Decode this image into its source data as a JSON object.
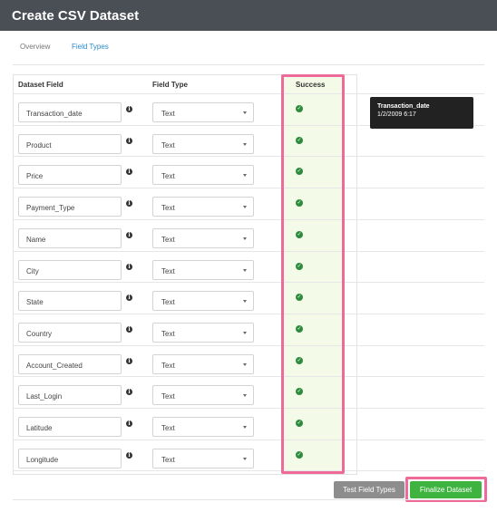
{
  "window": {
    "title": "Create CSV Dataset"
  },
  "tabs": [
    {
      "label": "Overview",
      "active": false
    },
    {
      "label": "Field Types",
      "active": true
    }
  ],
  "table": {
    "headers": {
      "field": "Dataset Field",
      "type": "Field Type",
      "success": "Success"
    },
    "rows": [
      {
        "field": "Transaction_date",
        "type": "Text",
        "success": true
      },
      {
        "field": "Product",
        "type": "Text",
        "success": true
      },
      {
        "field": "Price",
        "type": "Text",
        "success": true
      },
      {
        "field": "Payment_Type",
        "type": "Text",
        "success": true
      },
      {
        "field": "Name",
        "type": "Text",
        "success": true
      },
      {
        "field": "City",
        "type": "Text",
        "success": true
      },
      {
        "field": "State",
        "type": "Text",
        "success": true
      },
      {
        "field": "Country",
        "type": "Text",
        "success": true
      },
      {
        "field": "Account_Created",
        "type": "Text",
        "success": true
      },
      {
        "field": "Last_Login",
        "type": "Text",
        "success": true
      },
      {
        "field": "Latitude",
        "type": "Text",
        "success": true
      },
      {
        "field": "Longitude",
        "type": "Text",
        "success": true
      }
    ]
  },
  "tooltip": {
    "title": "Transaction_date",
    "value": "1/2/2009 6:17"
  },
  "buttons": {
    "test": "Test Field Types",
    "finalize": "Finalize Dataset"
  },
  "colors": {
    "titlebar": "#4a4f55",
    "accent_tab": "#2a8ac9",
    "success": "#2e8b3d",
    "success_bg": "#f3fbe8",
    "highlight": "#ee6a98",
    "finalize_button": "#3fb33f",
    "test_button": "#8d8d8d"
  },
  "icons": {
    "info": "info-icon",
    "success": "check-circle-icon",
    "dropdown": "chevron-down-icon"
  }
}
